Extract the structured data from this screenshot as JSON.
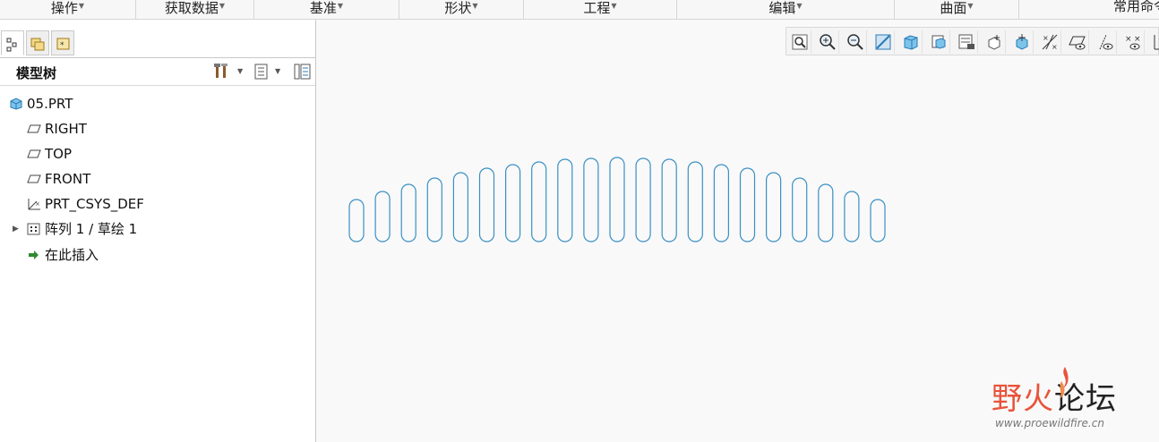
{
  "ribbon": {
    "groups": [
      {
        "label": "操作"
      },
      {
        "label": "获取数据"
      },
      {
        "label": "基准"
      },
      {
        "label": "形状"
      },
      {
        "label": "工程"
      },
      {
        "label": "编辑"
      },
      {
        "label": "曲面"
      },
      {
        "label": "常用命令"
      }
    ]
  },
  "panel": {
    "title": "模型树"
  },
  "tree": {
    "items": [
      {
        "label": "05.PRT",
        "icon": "part-icon"
      },
      {
        "label": "RIGHT",
        "icon": "datum-plane-icon"
      },
      {
        "label": "TOP",
        "icon": "datum-plane-icon"
      },
      {
        "label": "FRONT",
        "icon": "datum-plane-icon"
      },
      {
        "label": "PRT_CSYS_DEF",
        "icon": "csys-icon"
      },
      {
        "label": "阵列 1 / 草绘 1",
        "icon": "pattern-icon"
      },
      {
        "label": "在此插入",
        "icon": "insert-arrow-icon"
      }
    ]
  },
  "view_toolbar": {
    "buttons": [
      "refit-icon",
      "zoom-in-icon",
      "zoom-out-icon",
      "repaint-icon",
      "display-style-icon",
      "saved-views-icon",
      "view-manager-icon",
      "perspective-icon",
      "spin-center-icon",
      "datum-display-icon",
      "plane-display-icon",
      "axis-display-icon",
      "point-display-icon",
      "csys-display-icon"
    ]
  },
  "sketch": {
    "slot_count": 21,
    "slot_heights": [
      47,
      56,
      64,
      71,
      77,
      82,
      86,
      89,
      92,
      93,
      94,
      93,
      92,
      89,
      86,
      82,
      77,
      71,
      64,
      56,
      47
    ],
    "stroke_color": "#3a8fc4"
  },
  "watermark": {
    "text_colored": "野火",
    "text_dark": "论坛",
    "url": "www.proewildfire.cn"
  },
  "colors": {
    "accent": "#e8533a",
    "sketch": "#3a8fc4",
    "ribbon_bg": "#f7f7f7"
  }
}
